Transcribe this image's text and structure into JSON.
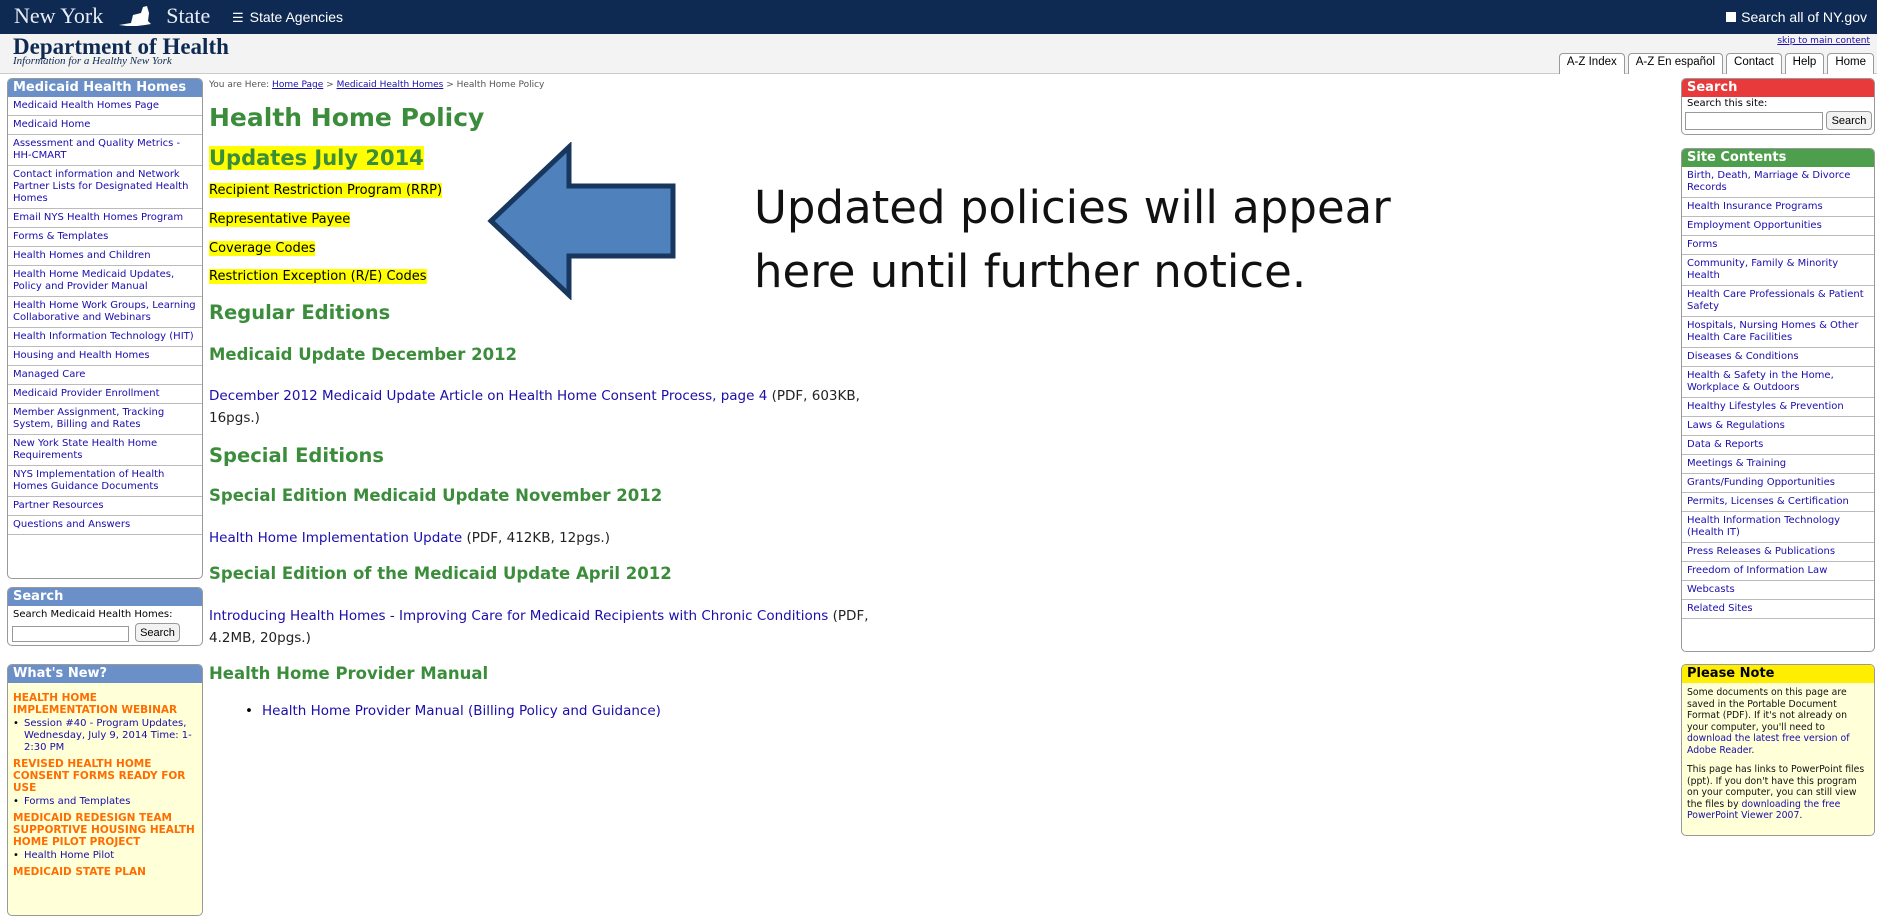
{
  "topbar": {
    "ny_left": "New York",
    "ny_right": "State",
    "agencies": "State Agencies",
    "search_all": "Search all of NY.gov"
  },
  "header": {
    "dept": "Department of Health",
    "tagline": "Information for a Healthy New York",
    "skip": "skip to main content",
    "tabs": [
      "A-Z Index",
      "A-Z En español",
      "Contact",
      "Help",
      "Home"
    ]
  },
  "left_nav": {
    "title": "Medicaid Health Homes",
    "items": [
      "Medicaid Health Homes Page",
      "Medicaid Home",
      "Assessment and Quality Metrics - HH-CMART",
      "Contact information and Network Partner Lists for Designated Health Homes",
      "Email NYS Health Homes Program",
      "Forms & Templates",
      "Health Homes and Children",
      "Health Home Medicaid Updates, Policy and Provider Manual",
      "Health Home Work Groups, Learning Collaborative and Webinars",
      "Health Information Technology (HIT)",
      "Housing and Health Homes",
      "Managed Care",
      "Medicaid Provider Enrollment",
      "Member Assignment, Tracking System, Billing and Rates",
      "New York State Health Home Requirements",
      "NYS Implementation of Health Homes Guidance Documents",
      "Partner Resources",
      "Questions and Answers"
    ]
  },
  "left_search": {
    "title": "Search",
    "label": "Search Medicaid Health Homes:",
    "button": "Search"
  },
  "whats_new": {
    "title": "What's New?",
    "entries": [
      {
        "head": "HEALTH HOME IMPLEMENTATION WEBINAR",
        "item": "Session #40 - Program Updates, Wednesday, July 9, 2014 Time: 1-2:30 PM"
      },
      {
        "head": "REVISED HEALTH HOME CONSENT FORMS READY FOR USE",
        "item": "Forms and Templates"
      },
      {
        "head": "MEDICAID REDESIGN TEAM SUPPORTIVE HOUSING HEALTH HOME PILOT PROJECT",
        "item": "Health Home Pilot"
      },
      {
        "head": "MEDICAID STATE PLAN",
        "item": ""
      }
    ]
  },
  "breadcrumb": {
    "prefix": "You are Here:",
    "home": "Home Page",
    "sep1": ">",
    "medicaid": "Medicaid Health Homes",
    "sep2": ">",
    "current": "Health Home Policy"
  },
  "main": {
    "title": "Health Home Policy",
    "updates_title": "Updates July 2014",
    "updates": [
      "Recipient Restriction Program (RRP)",
      "Representative Payee",
      "Coverage Codes",
      "Restriction Exception (R/E) Codes"
    ],
    "regular": "Regular Editions",
    "dec2012": "Medicaid Update December 2012",
    "dec_link": "December 2012 Medicaid Update Article on Health Home Consent Process, page 4",
    "dec_meta_1": " (PDF, 603KB,",
    "dec_meta_2": "16pgs.)",
    "special": "Special Editions",
    "nov2012": "Special Edition Medicaid Update November 2012",
    "nov_link": "Health Home Implementation Update",
    "nov_meta": " (PDF, 412KB, 12pgs.)",
    "apr2012": "Special Edition of the Medicaid Update April 2012",
    "apr_link": "Introducing Health Homes - Improving Care for Medicaid Recipients with Chronic Conditions",
    "apr_meta_1": " (PDF,",
    "apr_meta_2": "4.2MB, 20pgs.)",
    "manual": "Health Home Provider Manual",
    "manual_link": "Health Home Provider Manual (Billing Policy and Guidance)"
  },
  "callout": {
    "line1": "Updated policies will appear",
    "line2": "here until further notice.",
    "arrow_color": "#4f81bd"
  },
  "right_search": {
    "title": "Search",
    "label": "Search this site:",
    "button": "Search"
  },
  "site_contents": {
    "title": "Site Contents",
    "items": [
      "Birth, Death, Marriage & Divorce Records",
      "Health Insurance Programs",
      "Employment Opportunities",
      "Forms",
      "Community, Family & Minority Health",
      "Health Care Professionals & Patient Safety",
      "Hospitals, Nursing Homes & Other Health Care Facilities",
      "Diseases & Conditions",
      "Health & Safety in the Home, Workplace & Outdoors",
      "Healthy Lifestyles & Prevention",
      "Laws & Regulations",
      "Data & Reports",
      "Meetings & Training",
      "Grants/Funding Opportunities",
      "Permits, Licenses & Certification",
      "Health Information Technology (Health IT)",
      "Press Releases & Publications",
      "Freedom of Information Law",
      "Webcasts",
      "Related Sites"
    ]
  },
  "please_note": {
    "title": "Please Note",
    "p1_text": "Some documents on this page are saved in the Portable Document Format (PDF). If it's not already on your computer, you'll need to ",
    "p1_link": "download the latest free version of Adobe Reader",
    "p1_end": ".",
    "p2_text": "This page has links to PowerPoint files (ppt). If you don't have this program on your computer, you can still view the files by ",
    "p2_link": "downloading the free PowerPoint Viewer 2007",
    "p2_end": "."
  }
}
